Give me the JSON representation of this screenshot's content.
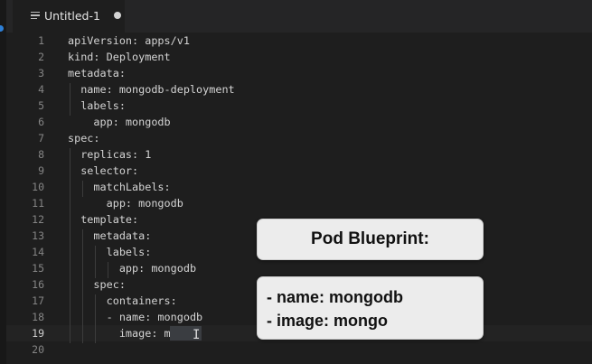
{
  "tab": {
    "title": "Untitled-1",
    "icon": "file-lines-icon",
    "modified": true
  },
  "editor": {
    "cursor_line": 19,
    "lines": [
      {
        "no": "1",
        "text": "apiVersion: apps/v1"
      },
      {
        "no": "2",
        "text": "kind: Deployment"
      },
      {
        "no": "3",
        "text": "metadata:"
      },
      {
        "no": "4",
        "text": "  name: mongodb-deployment"
      },
      {
        "no": "5",
        "text": "  labels:"
      },
      {
        "no": "6",
        "text": "    app: mongodb"
      },
      {
        "no": "7",
        "text": "spec:"
      },
      {
        "no": "8",
        "text": "  replicas: 1"
      },
      {
        "no": "9",
        "text": "  selector:"
      },
      {
        "no": "10",
        "text": "    matchLabels:"
      },
      {
        "no": "11",
        "text": "      app: mongodb"
      },
      {
        "no": "12",
        "text": "  template:"
      },
      {
        "no": "13",
        "text": "    metadata:"
      },
      {
        "no": "14",
        "text": "      labels:"
      },
      {
        "no": "15",
        "text": "        app: mongodb"
      },
      {
        "no": "16",
        "text": "    spec:"
      },
      {
        "no": "17",
        "text": "      containers:"
      },
      {
        "no": "18",
        "text": "      - name: mongodb"
      },
      {
        "no": "19",
        "text": "        image: mongo"
      },
      {
        "no": "20",
        "text": ""
      }
    ]
  },
  "overlay": {
    "title": "Pod Blueprint:",
    "items": [
      "- name: mongodb",
      "- image: mongo"
    ]
  },
  "colors": {
    "background": "#1e1e1e",
    "text": "#d4d4d4",
    "callout": "#ececec"
  }
}
